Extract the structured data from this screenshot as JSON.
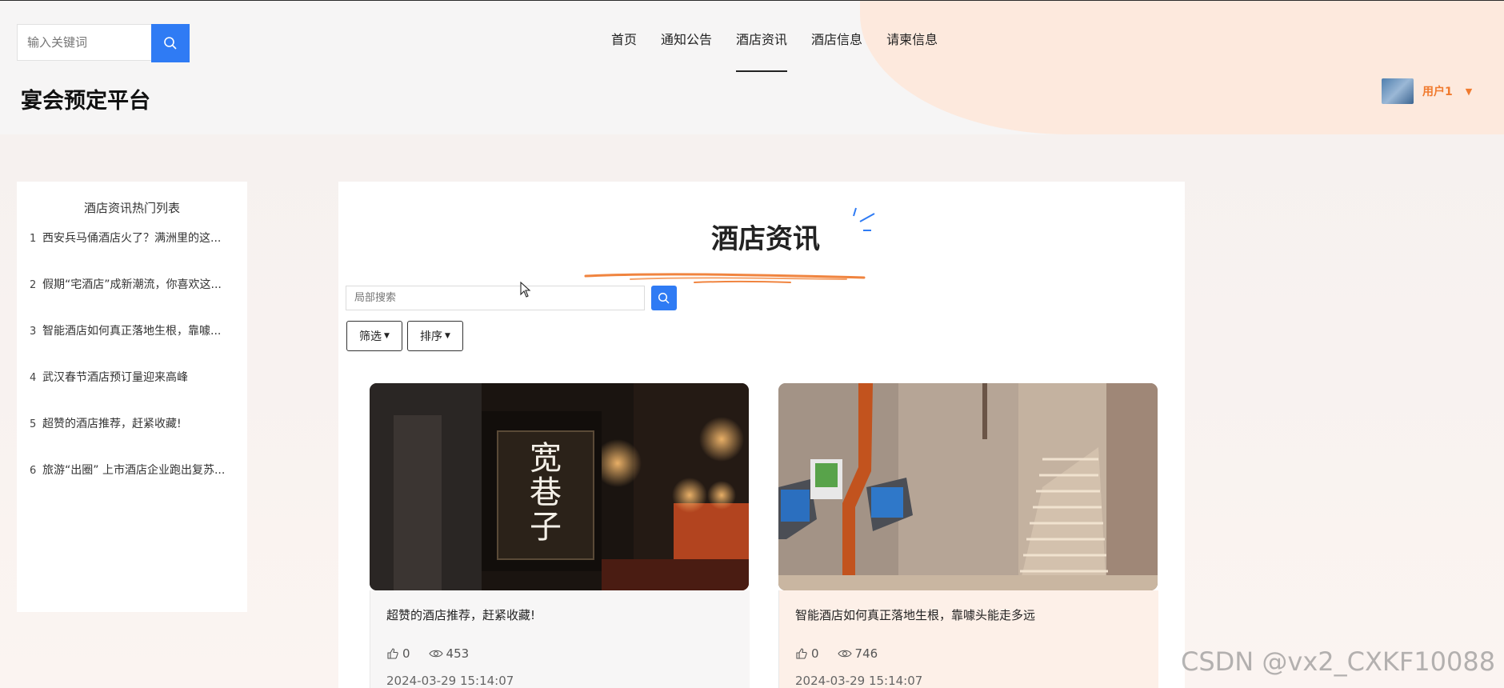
{
  "header": {
    "search_placeholder": "输入关键词",
    "site_title": "宴会预定平台",
    "nav": [
      "首页",
      "通知公告",
      "酒店资讯",
      "酒店信息",
      "请柬信息"
    ],
    "active_nav": "酒店资讯",
    "user_name": "用户1"
  },
  "sidebar": {
    "title": "酒店资讯热门列表",
    "items": [
      {
        "num": "1",
        "text": "西安兵马俑酒店火了？满洲里的这..."
      },
      {
        "num": "2",
        "text": "假期“宅酒店”成新潮流，你喜欢这..."
      },
      {
        "num": "3",
        "text": "智能酒店如何真正落地生根，靠噱..."
      },
      {
        "num": "4",
        "text": "武汉春节酒店预订量迎来高峰"
      },
      {
        "num": "5",
        "text": "超赞的酒店推荐，赶紧收藏!"
      },
      {
        "num": "6",
        "text": "旅游“出圈” 上市酒店企业跑出复苏..."
      }
    ]
  },
  "main": {
    "title": "酒店资讯",
    "search_placeholder": "局部搜索",
    "filter_label": "筛选",
    "sort_label": "排序",
    "cards": [
      {
        "title": "超赞的酒店推荐，赶紧收藏!",
        "likes": "0",
        "views": "453",
        "date": "2024-03-29 15:14:07",
        "sign_text": "宽巷子"
      },
      {
        "title": "智能酒店如何真正落地生根，靠噱头能走多远",
        "likes": "0",
        "views": "746",
        "date": "2024-03-29 15:14:07"
      }
    ]
  },
  "watermark": "CSDN @vx2_CXKF10088",
  "colors": {
    "accent": "#2f7bf4",
    "user": "#f07a2e",
    "blob": "#fde9dd"
  }
}
